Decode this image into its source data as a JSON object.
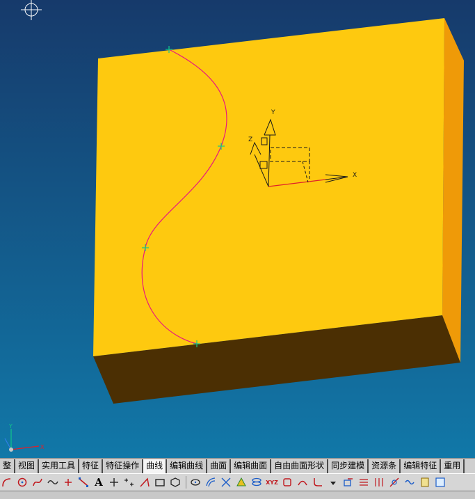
{
  "colors": {
    "bg_top": "#163a6b",
    "bg_bottom": "#1178a8",
    "face_front": "#fec90f",
    "face_side": "#ef9a08",
    "face_bottom": "#4b2f03",
    "curve": "#e8187e",
    "control_point": "#11c88a",
    "csys": "#191919",
    "csys_x_axis": "#e0202a"
  },
  "viewport": {
    "crosshair_icon": "crosshair-icon",
    "csys_labels": {
      "x": "X",
      "y": "Y",
      "z": "Z"
    },
    "triad_labels": {
      "x": "X",
      "y": "Y"
    }
  },
  "ribbon_tabs": [
    {
      "label": "整"
    },
    {
      "label": "视图"
    },
    {
      "label": "实用工具"
    },
    {
      "label": "特征"
    },
    {
      "label": "特征操作"
    },
    {
      "label": "曲线",
      "active": true
    },
    {
      "label": "编辑曲线"
    },
    {
      "label": "曲面"
    },
    {
      "label": "编辑曲面"
    },
    {
      "label": "自由曲面形状"
    },
    {
      "label": "同步建模"
    },
    {
      "label": "资源条"
    },
    {
      "label": "编辑特征"
    },
    {
      "label": "重用"
    }
  ],
  "toolbar": {
    "text_tool_label": "A",
    "xyz_label": "XYZ",
    "icons": [
      "arc-icon",
      "circle-icon",
      "spline-icon",
      "wave-icon",
      "point-icon",
      "line-icon",
      "text-icon",
      "plus-icon",
      "point-set-icon",
      "corner-icon",
      "rectangle-icon",
      "polygon-icon",
      "ellipse-icon",
      "offset-curve-icon",
      "intersect-icon",
      "project-icon",
      "helix-icon",
      "xyz-expression-icon",
      "law-curve-icon",
      "bridge-icon",
      "fillet-curve-icon",
      "dropdown-icon",
      "extract-icon",
      "section-icon",
      "isoparametric-icon",
      "trim-icon",
      "join-icon",
      "edit-params-icon",
      "edit-length-icon"
    ]
  }
}
